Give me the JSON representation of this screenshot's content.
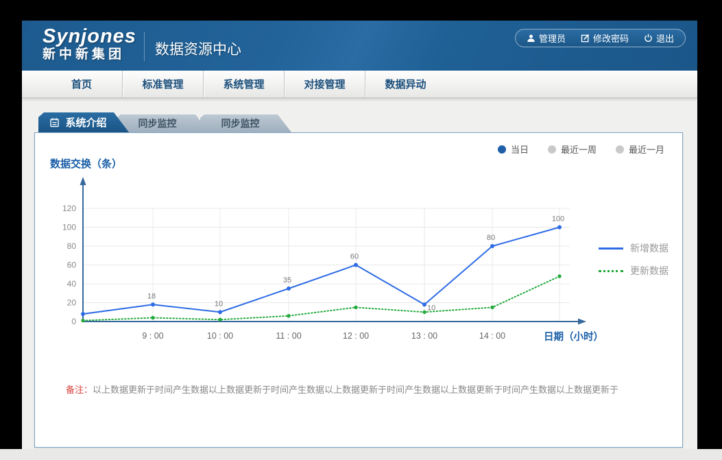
{
  "header": {
    "logo_primary": "Synjones",
    "logo_secondary": "新中新集团",
    "app_title": "数据资源中心",
    "user_label": "管理员",
    "change_password_label": "修改密码",
    "logout_label": "退出"
  },
  "nav": {
    "items": [
      {
        "label": "首页"
      },
      {
        "label": "标准管理"
      },
      {
        "label": "系统管理"
      },
      {
        "label": "对接管理"
      },
      {
        "label": "数据异动"
      }
    ]
  },
  "tabs": [
    {
      "label": "系统介绍",
      "active": true
    },
    {
      "label": "同步监控",
      "active": false
    },
    {
      "label": "同步监控",
      "active": false
    }
  ],
  "filters": {
    "options": [
      {
        "label": "当日",
        "selected": true
      },
      {
        "label": "最近一周",
        "selected": false
      },
      {
        "label": "最近一月",
        "selected": false
      }
    ]
  },
  "chart_data": {
    "type": "line",
    "ylabel": "数据交换（条）",
    "xlabel": "日期（小时）",
    "categories": [
      "",
      "9 : 00",
      "10 : 00",
      "11 : 00",
      "12 : 00",
      "13 : 00",
      "14 : 00",
      ""
    ],
    "yticks": [
      0,
      20,
      40,
      60,
      80,
      100,
      120
    ],
    "ylim": [
      0,
      130
    ],
    "grid": true,
    "legend_position": "right",
    "series": [
      {
        "name": "新增数据",
        "color": "#2e6ce5",
        "line_style": "solid",
        "values": [
          8,
          18,
          10,
          35,
          60,
          18,
          80,
          100
        ],
        "point_labels": [
          "",
          "18",
          "10",
          "35",
          "60",
          "",
          "80",
          "100"
        ]
      },
      {
        "name": "更新数据",
        "color": "#21a93a",
        "line_style": "dotted",
        "values": [
          1,
          4,
          2,
          6,
          15,
          10,
          15,
          48
        ],
        "point_labels": [
          "",
          "",
          "",
          "",
          "",
          "10",
          "",
          ""
        ]
      }
    ]
  },
  "remark": {
    "prefix": "备注：",
    "text": "以上数据更新于时间产生数据以上数据更新于时间产生数据以上数据更新于时间产生数据以上数据更新于时间产生数据以上数据更新于"
  },
  "colors": {
    "header_blue": "#1f6095",
    "nav_text": "#1b4f7c",
    "active_tab": "#1d5c8f",
    "inactive_tab": "#a6b4c1",
    "panel_border": "#7ba3c6",
    "axis_blue": "#36689c",
    "line_blue": "#2e6ce5",
    "line_green": "#21a93a",
    "remark_red": "#d9413d",
    "radio_selected": "#1f5ea9"
  }
}
